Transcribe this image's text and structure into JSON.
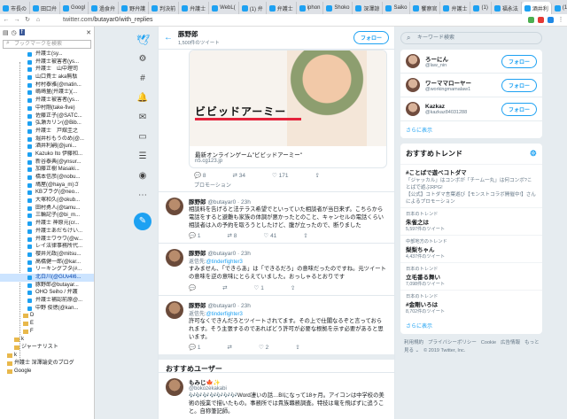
{
  "browser": {
    "tabs": [
      "市長の",
      "田口弁",
      "Googl",
      "過食弁",
      "野弁護",
      "判決前",
      "弁護士",
      "WebL(",
      "(1) 弁",
      "弁護士",
      "iphon",
      "Shoko",
      "深澤諒",
      "Saiko",
      "饗察官",
      "弁護士",
      "(1)",
      "福永法",
      "酒井利",
      "(1)"
    ],
    "url_host": "twitter.com",
    "url_path": "/butayar0/with_replies"
  },
  "bookmarks": {
    "search_placeholder": "ブックマークを検索",
    "items": [
      "弁護士(sy...",
      "弁護士被害者(ys...",
      "弁護士　山中理司",
      "山口貴士 aka無駄",
      "村村泰雅(@matin...",
      "嶋崎量(弁護士)(...",
      "弁護士被害者(ys...",
      "中村剛(take-five)",
      "佐藤正子(@SATC...",
      "弘瀬カリン(@Bib...",
      "弁護士　戸舘圭之",
      "堀井杉もうのめ(@...",
      "酒井利嗣(@juni...",
      "Kazuko Ito 伊藤和...",
      "新谷泰典(@ynsur...",
      "加藤正樹 Masaki...",
      "橋本信彦(@nobu...",
      "鳩屋(@haya_m)さ",
      "KBプラグ(@neo...",
      "大塚和久(@okub...",
      "田村勇人(@tamu...",
      "三輪記子(@bi_m...",
      "弁護士 神原元(cr...",
      "弁護士あだちけい...",
      "弁護士ワウワ(@w...",
      "レイ法律事務所代...",
      "櫻井光政(@mitsu...",
      "高橋健一郎(@kar...",
      "リーキングブタ(#...",
      "北白川(@GUv4I6...",
      "豚野郎@butayar...",
      "OHO Seiho / 弁護",
      "弁護士補認前原@...",
      "中野 俊徳(@kan..."
    ],
    "folders": [
      "D",
      "E",
      "F",
      "k",
      "ジャーナリスト",
      "k",
      "弁護士 深澤諭史のブログ",
      "Google"
    ]
  },
  "main": {
    "back": "←",
    "name": "豚野郎",
    "tweet_count": "1,500件のツイート",
    "follow": "フォロー",
    "card_logo": "ビビッドアーミー",
    "card_title": "最新オンラインゲーム\"ビビッドアーミー\"",
    "card_url": "n5.cg123.jp",
    "card_stats": {
      "replies": "8",
      "retweets": "34",
      "likes": "171"
    },
    "promo": "プロモーション",
    "tweets": [
      {
        "name": "豚野郎",
        "handle": "@butayar0 · 23h",
        "body": "相談料を告げると法テラス希望でといっていた相談者が当日来ず。こちらから電話をすると避難も家族の体調が悪かったとのこと、キャンセルの電話くらい相談者は入の予約を取ろうとしたけど、腹が立ったので、断りました",
        "stats": {
          "replies": "1",
          "retweets": "8",
          "likes": "41"
        }
      },
      {
        "name": "豚野郎",
        "handle": "@butayar0 · 23h",
        "reply_to": "@tinderfighter3",
        "body": "すみません、「できらあ」は「できるだろ」の意味だったのですね。元ツイートの意味を逆の意味にとらえていました。おっしゃるとおりです",
        "stats": {
          "replies": "",
          "retweets": "",
          "likes": "1"
        }
      },
      {
        "name": "豚野郎",
        "handle": "@butayar0 · 23h",
        "reply_to": "@tinderfighter3",
        "body": "許可なくできんだろとツイートされてます。その上で仕閣なるぞと言っておられます。そう主張するのであればどう許可が必要な根拠を示す必要があると思います。",
        "stats": {
          "replies": "1",
          "retweets": "",
          "likes": "2"
        }
      }
    ],
    "reply_prefix": "返信先:",
    "recommended_head": "おすすめユーザー",
    "rec_user": {
      "name": "もみじ🍁✨",
      "handle": "@bokozekakabi",
      "body": "🎶🎶🎶🎶🎶🎶🎶Word凄いの話…BIになって18ヶ月。アイコンは中学校の美術の授業で描いたもの。事務所では貴族職務調査。特技は竜を飛ばずに追うこと。自称筆記師。"
    }
  },
  "right": {
    "search_placeholder": "キーワード検索",
    "users": [
      {
        "name": "ろーにん",
        "handle": "@law_nin",
        "follow": "フォロー"
      },
      {
        "name": "ワーママローヤー",
        "handle": "@workingmamalaw1",
        "follow": "フォロー"
      },
      {
        "name": "Kazkaz",
        "handle": "@kazkaz84031288",
        "follow": "フォロー"
      }
    ],
    "more": "さらに表示",
    "trends_head": "おすすめトレンド",
    "trends": [
      {
        "title": "#ことばで遊べコトダマ",
        "desc": "「ジャッカル」はコンボが「チーム一丸」は何コンボ?ことばで遊ぶRPG!",
        "promo": "【公式】コトダマ言葉遊び【モンストコラボ開催中!】さんによるプロモーション"
      },
      {
        "ctx": "日本のトレンド",
        "title": "朱雀之は",
        "count": "5,597件のツイート"
      },
      {
        "ctx": "中部地方のトレンド",
        "title": "梨梨ちゃん",
        "count": "4,437件のツイート"
      },
      {
        "ctx": "日本のトレンド",
        "title": "立毛番る舞い",
        "count": "7,098件のツイート"
      },
      {
        "ctx": "日本のトレンド",
        "title": "#金剛いろは",
        "count": "8,702件のツイート"
      }
    ],
    "footer": [
      "利用規約",
      "プライバシーポリシー",
      "Cookie",
      "広告情報",
      "もっと見る ⌄",
      "© 2019 Twitter, Inc."
    ]
  }
}
